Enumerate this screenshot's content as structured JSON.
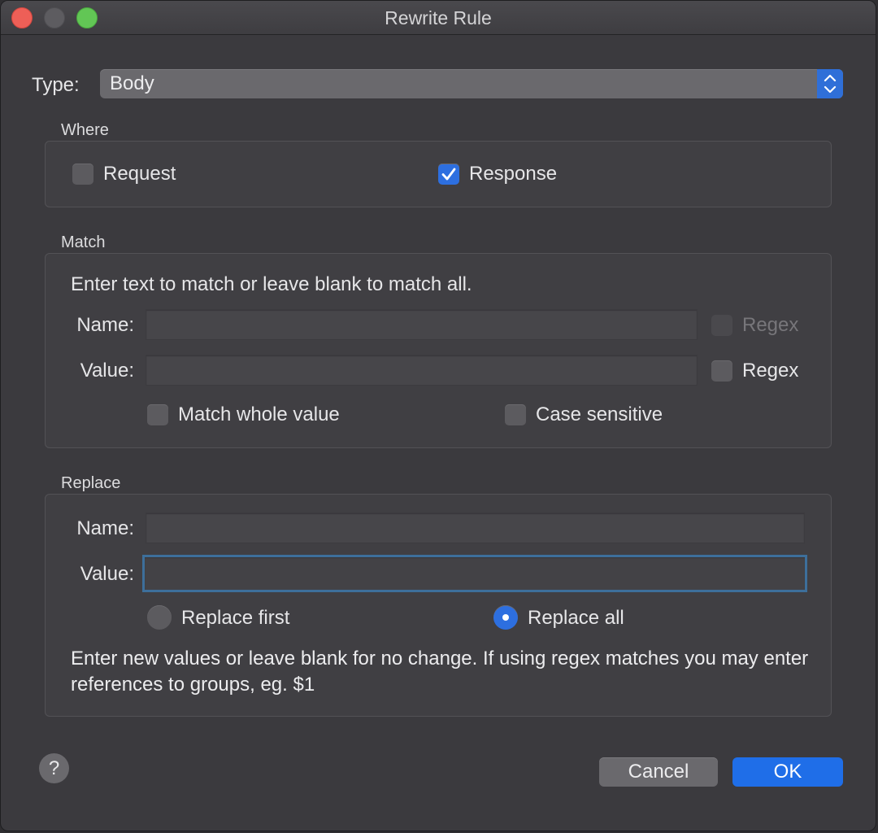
{
  "window": {
    "title": "Rewrite Rule"
  },
  "type": {
    "label": "Type:",
    "value": "Body"
  },
  "where": {
    "title": "Where",
    "request": {
      "label": "Request",
      "checked": false
    },
    "response": {
      "label": "Response",
      "checked": true
    }
  },
  "match": {
    "title": "Match",
    "instructions": "Enter text to match or leave blank to match all.",
    "name_label": "Name:",
    "name_value": "",
    "name_regex_label": "Regex",
    "value_label": "Value:",
    "value_value": "",
    "value_regex_label": "Regex",
    "match_whole_label": "Match whole value",
    "case_sensitive_label": "Case sensitive"
  },
  "replace": {
    "title": "Replace",
    "name_label": "Name:",
    "name_value": "",
    "value_label": "Value:",
    "value_value": "",
    "replace_first_label": "Replace first",
    "replace_all_label": "Replace all",
    "selected": "Replace all",
    "help_text": "Enter new values or leave blank for no change. If using regex matches you may enter references to groups, eg. $1"
  },
  "buttons": {
    "help": "?",
    "cancel": "Cancel",
    "ok": "OK"
  },
  "colors": {
    "accent": "#2d6fe0",
    "ok_button": "#1f6ee8",
    "window_bg": "#3b3a3e"
  }
}
